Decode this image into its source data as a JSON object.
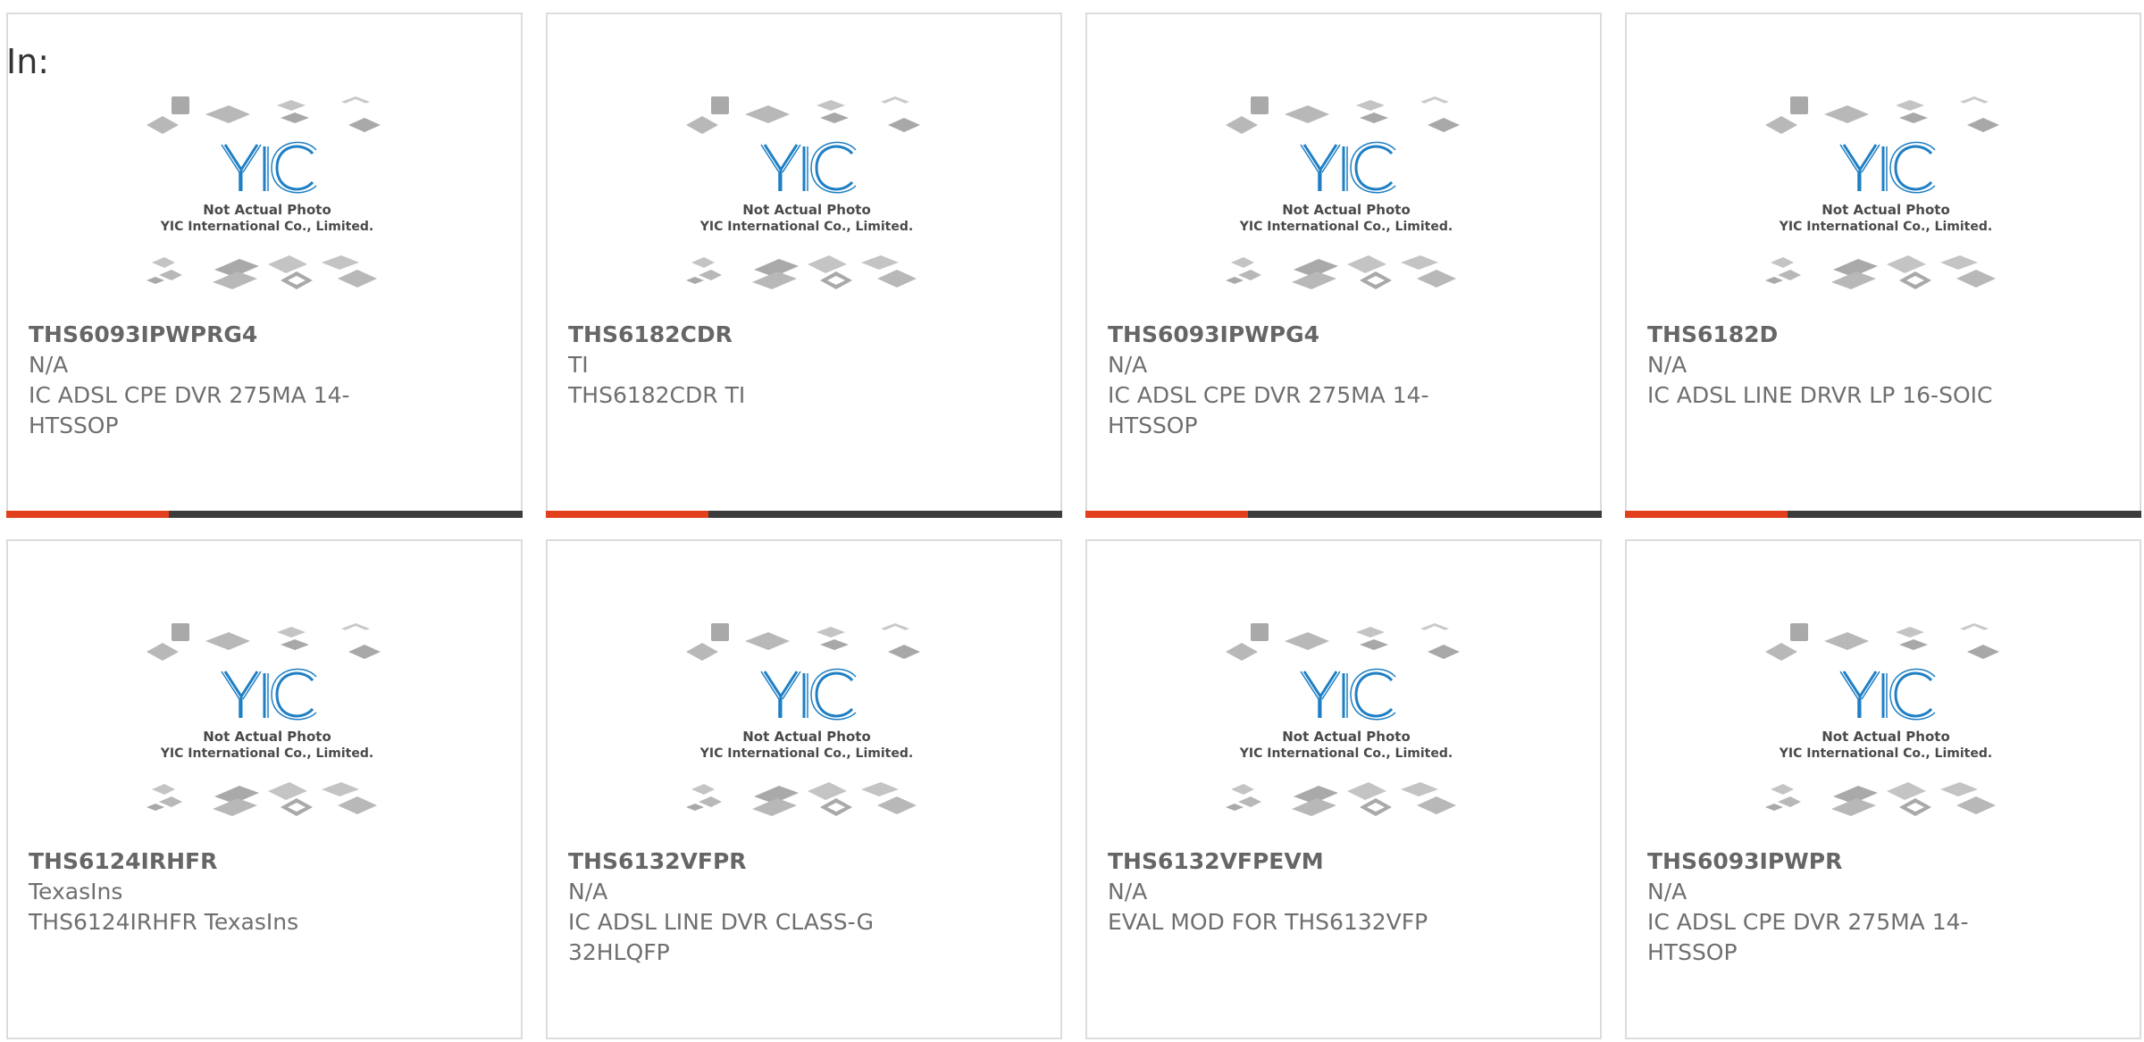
{
  "filter_label": "In:",
  "placeholder_photo": {
    "caption_line1": "Not Actual Photo",
    "caption_line2": "YIC International Co., Limited.",
    "logo_text": "YIC"
  },
  "colors": {
    "accent": "#e2401c",
    "bar_dark": "#3c3c3c",
    "logo_blue": "#1f7fc4",
    "chip_gray": "#b5b5b5"
  },
  "products": [
    {
      "part_number": "THS6093IPWPRG4",
      "manufacturer": "N/A",
      "description": "IC ADSL CPE DVR 275MA 14-HTSSOP"
    },
    {
      "part_number": "THS6182CDR",
      "manufacturer": "TI",
      "description": "THS6182CDR TI"
    },
    {
      "part_number": "THS6093IPWPG4",
      "manufacturer": "N/A",
      "description": "IC ADSL CPE DVR 275MA 14-HTSSOP"
    },
    {
      "part_number": "THS6182D",
      "manufacturer": "N/A",
      "description": "IC ADSL LINE DRVR LP 16-SOIC"
    },
    {
      "part_number": "THS6124IRHFR",
      "manufacturer": "TexasIns",
      "description": "THS6124IRHFR TexasIns"
    },
    {
      "part_number": "THS6132VFPR",
      "manufacturer": "N/A",
      "description": "IC ADSL LINE DVR CLASS-G 32HLQFP"
    },
    {
      "part_number": "THS6132VFPEVM",
      "manufacturer": "N/A",
      "description": "EVAL MOD FOR THS6132VFP"
    },
    {
      "part_number": "THS6093IPWPR",
      "manufacturer": "N/A",
      "description": "IC ADSL CPE DVR 275MA 14-HTSSOP"
    }
  ]
}
